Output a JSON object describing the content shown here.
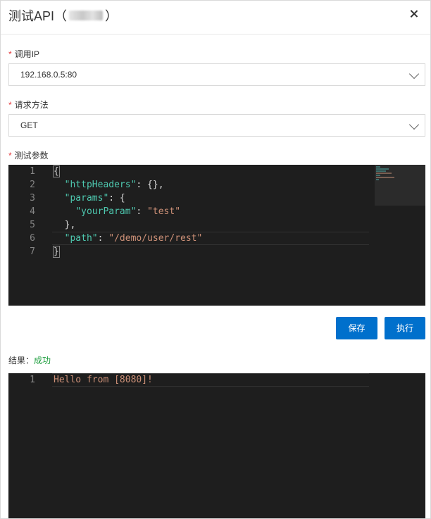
{
  "dialog": {
    "title_prefix": "测试API（",
    "title_suffix": "）"
  },
  "fields": {
    "ip": {
      "required_mark": "*",
      "label": "调用IP",
      "value": "192.168.0.5:80"
    },
    "method": {
      "required_mark": "*",
      "label": "请求方法",
      "value": "GET"
    },
    "params": {
      "required_mark": "*",
      "label": "测试参数"
    }
  },
  "params_editor": {
    "line_numbers": [
      "1",
      "2",
      "3",
      "4",
      "5",
      "6",
      "7"
    ],
    "lines": [
      {
        "indent": "",
        "tokens": [
          {
            "t": "{",
            "c": "p"
          }
        ]
      },
      {
        "indent": "  ",
        "tokens": [
          {
            "t": "\"httpHeaders\"",
            "c": "key"
          },
          {
            "t": ": {},",
            "c": "p"
          }
        ]
      },
      {
        "indent": "  ",
        "tokens": [
          {
            "t": "\"params\"",
            "c": "key"
          },
          {
            "t": ": {",
            "c": "p"
          }
        ]
      },
      {
        "indent": "    ",
        "tokens": [
          {
            "t": "\"yourParam\"",
            "c": "key"
          },
          {
            "t": ": ",
            "c": "p"
          },
          {
            "t": "\"test\"",
            "c": "s"
          }
        ]
      },
      {
        "indent": "  ",
        "tokens": [
          {
            "t": "},",
            "c": "p"
          }
        ]
      },
      {
        "indent": "  ",
        "tokens": [
          {
            "t": "\"path\"",
            "c": "key"
          },
          {
            "t": ": ",
            "c": "p"
          },
          {
            "t": "\"/demo/user/rest\"",
            "c": "s"
          }
        ]
      },
      {
        "indent": "",
        "tokens": [
          {
            "t": "}",
            "c": "p"
          }
        ]
      }
    ]
  },
  "actions": {
    "save_label": "保存",
    "run_label": "执行"
  },
  "result": {
    "label": "结果：",
    "status": "成功",
    "line_numbers": [
      "1"
    ],
    "output": "Hello from [8080]!"
  },
  "colors": {
    "primary": "#0070cc",
    "success": "#1e9e3e",
    "required": "#e4393c",
    "editor_bg": "#1e1e1e",
    "json_key": "#4ec9b0",
    "json_string": "#ce9178"
  }
}
